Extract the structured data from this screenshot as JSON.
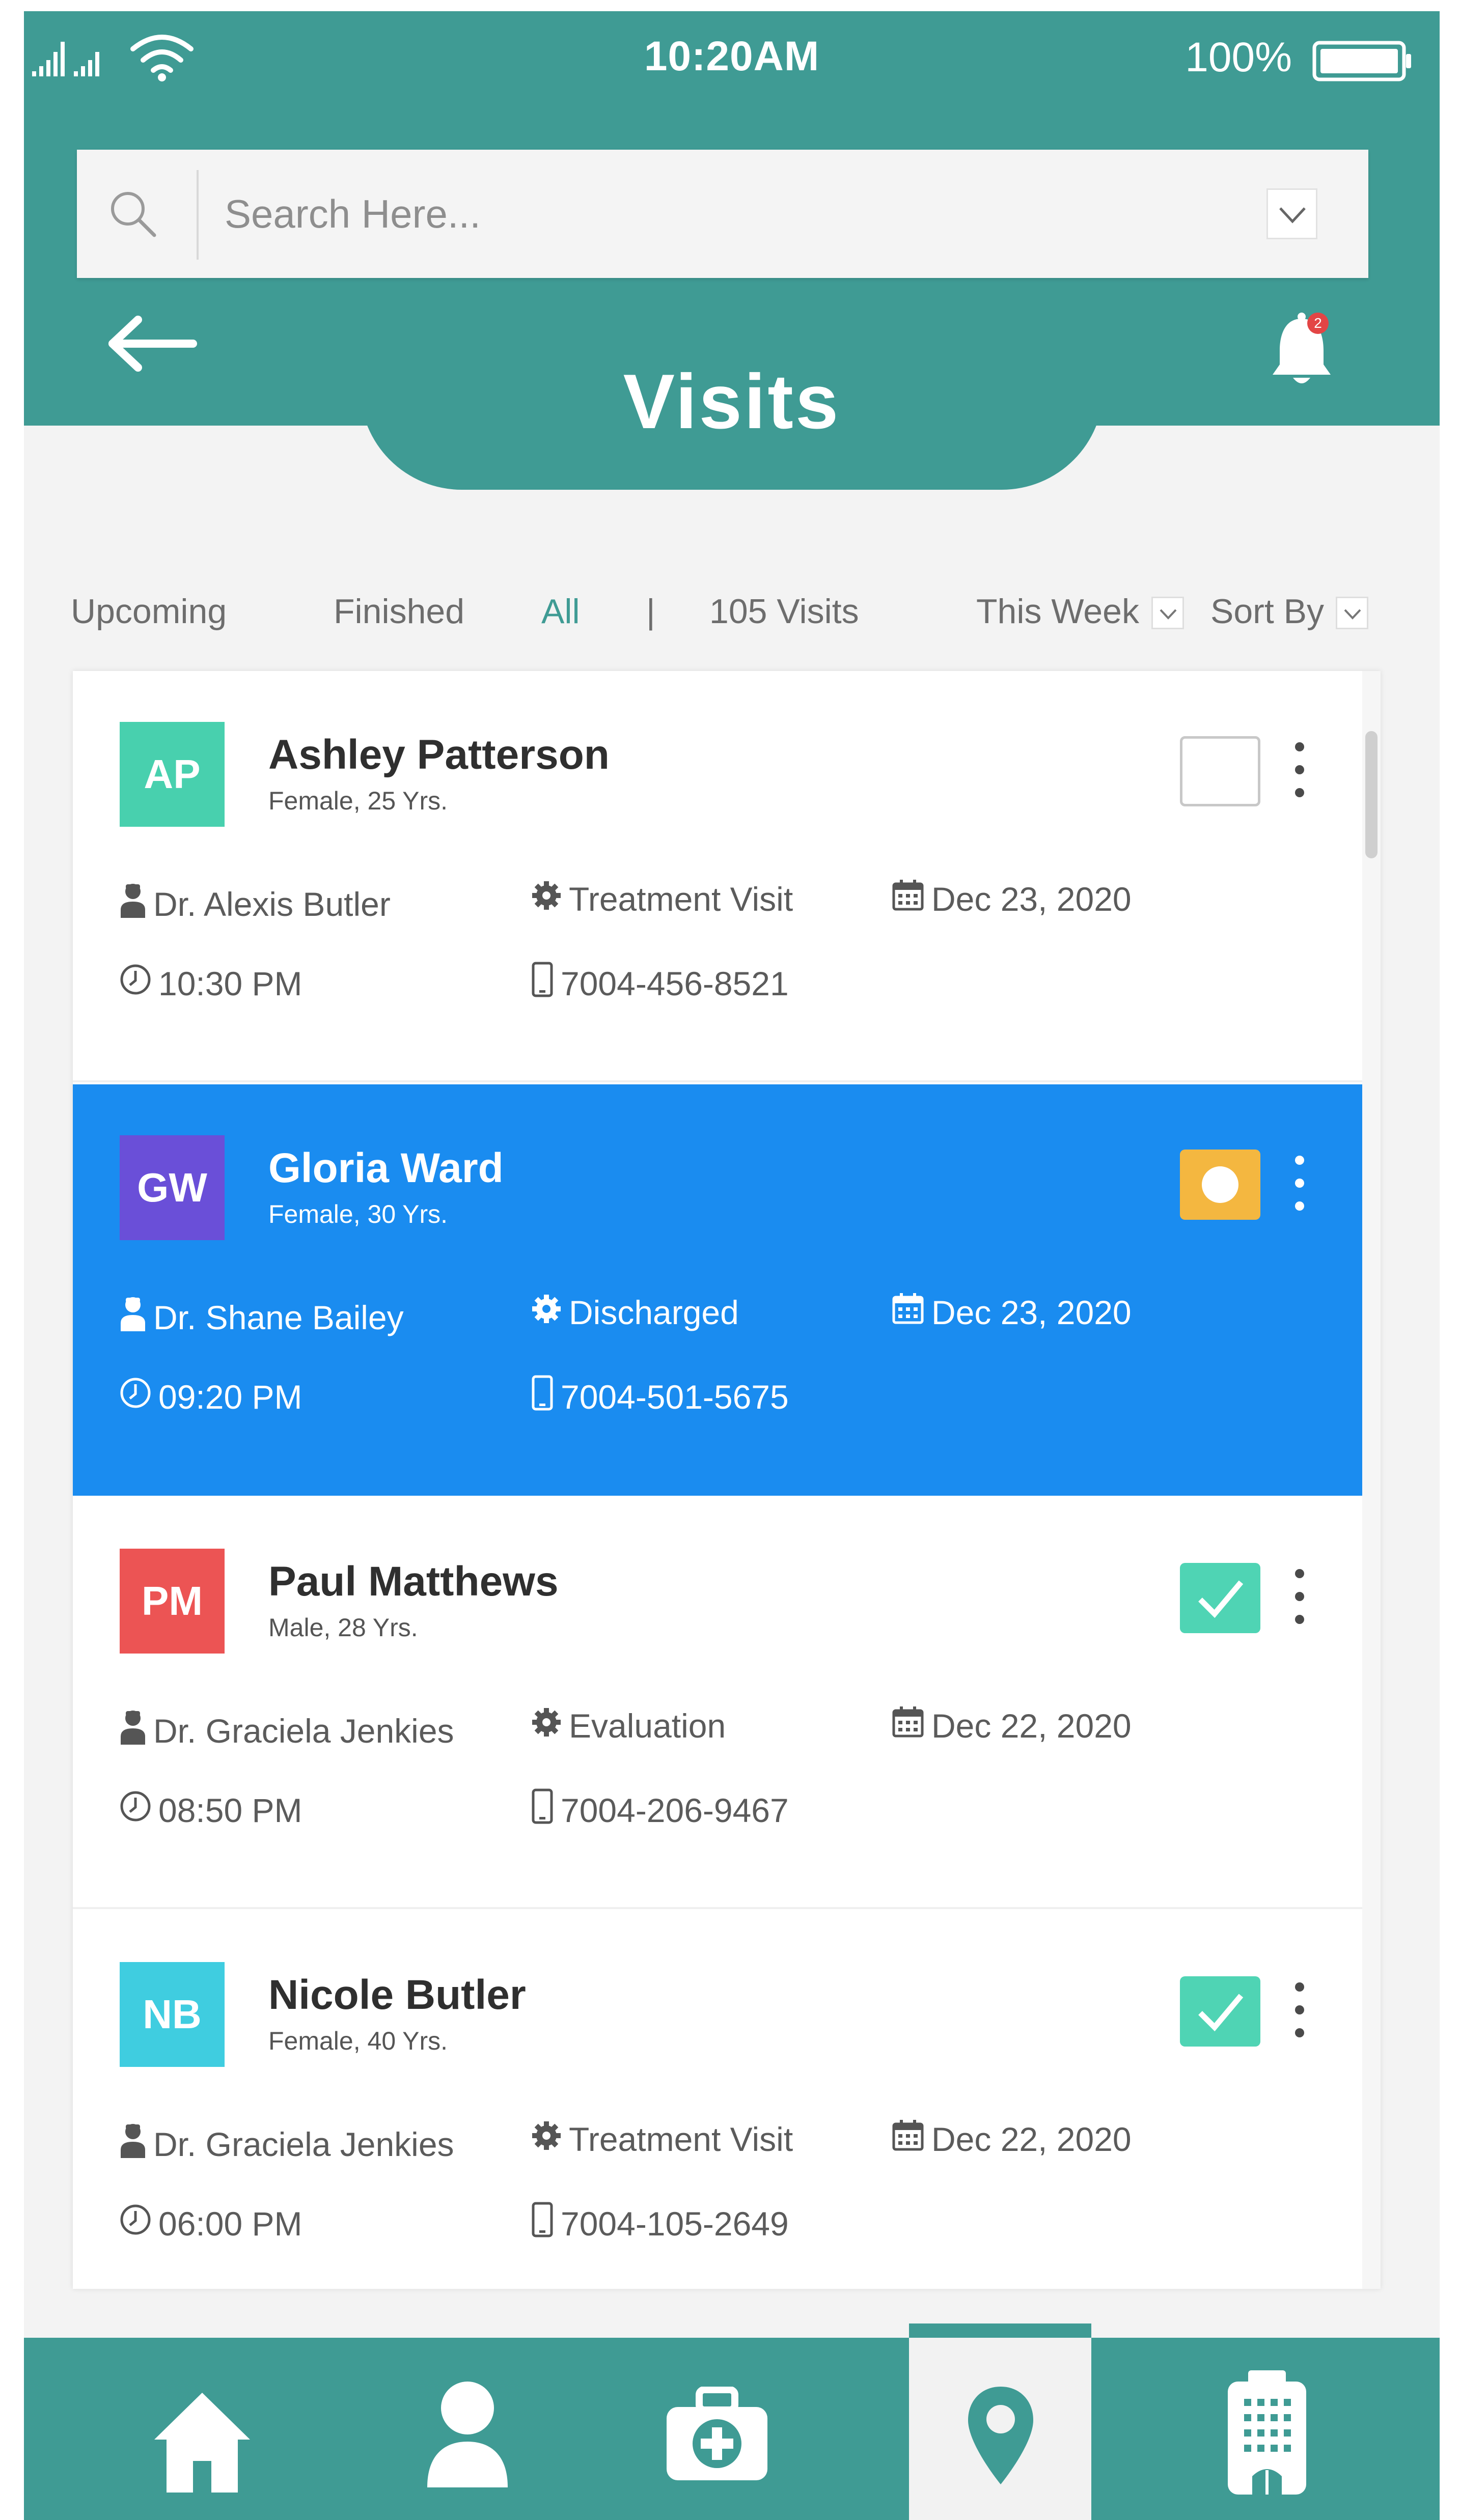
{
  "colors": {
    "primary": "#3f9b94",
    "selected_row": "#1a8cf0",
    "checked": "#4fd4b4",
    "partial": "#f4b740"
  },
  "status_bar": {
    "time": "10:20AM",
    "battery": "100%",
    "icons": [
      "signal-icon",
      "wifi-icon",
      "battery-icon"
    ]
  },
  "search": {
    "placeholder": "Search Here...",
    "value": ""
  },
  "header": {
    "title": "Visits",
    "notification_count": "2"
  },
  "filters": {
    "tabs": [
      "Upcoming",
      "Finished",
      "All"
    ],
    "active_tab": "All",
    "separator": "|",
    "visit_count": "105 Visits",
    "period": "This Week",
    "sort": "Sort By"
  },
  "visits": [
    {
      "initials": "AP",
      "avatar_color": "#48d0ae",
      "name": "Ashley Patterson",
      "info": "Female, 25 Yrs.",
      "doctor": "Dr. Alexis Butler",
      "type": "Treatment Visit",
      "date": "Dec 23, 2020",
      "time": "10:30 PM",
      "phone": "7004-456-8521",
      "checkbox": "empty"
    },
    {
      "initials": "GW",
      "avatar_color": "#6a4fd8",
      "name": "Gloria Ward",
      "info": "Female, 30 Yrs.",
      "doctor": "Dr. Shane Bailey",
      "type": "Discharged",
      "date": "Dec 23, 2020",
      "time": "09:20 PM",
      "phone": "7004-501-5675",
      "checkbox": "partial"
    },
    {
      "initials": "PM",
      "avatar_color": "#ec5454",
      "name": "Paul Matthews",
      "info": "Male, 28 Yrs.",
      "doctor": "Dr. Graciela Jenkies",
      "type": "Evaluation",
      "date": "Dec 22, 2020",
      "time": "08:50 PM",
      "phone": "7004-206-9467",
      "checkbox": "checked"
    },
    {
      "initials": "NB",
      "avatar_color": "#3fcde0",
      "name": "Nicole Butler",
      "info": "Female, 40 Yrs.",
      "doctor": "Dr. Graciela Jenkies",
      "type": "Treatment Visit",
      "date": "Dec 22, 2020",
      "time": "06:00 PM",
      "phone": "7004-105-2649",
      "checkbox": "checked"
    }
  ],
  "bottom_nav": {
    "items": [
      "home-icon",
      "user-icon",
      "medical-kit-icon",
      "location-pin-icon",
      "hospital-building-icon"
    ],
    "active": "location-pin-icon"
  }
}
